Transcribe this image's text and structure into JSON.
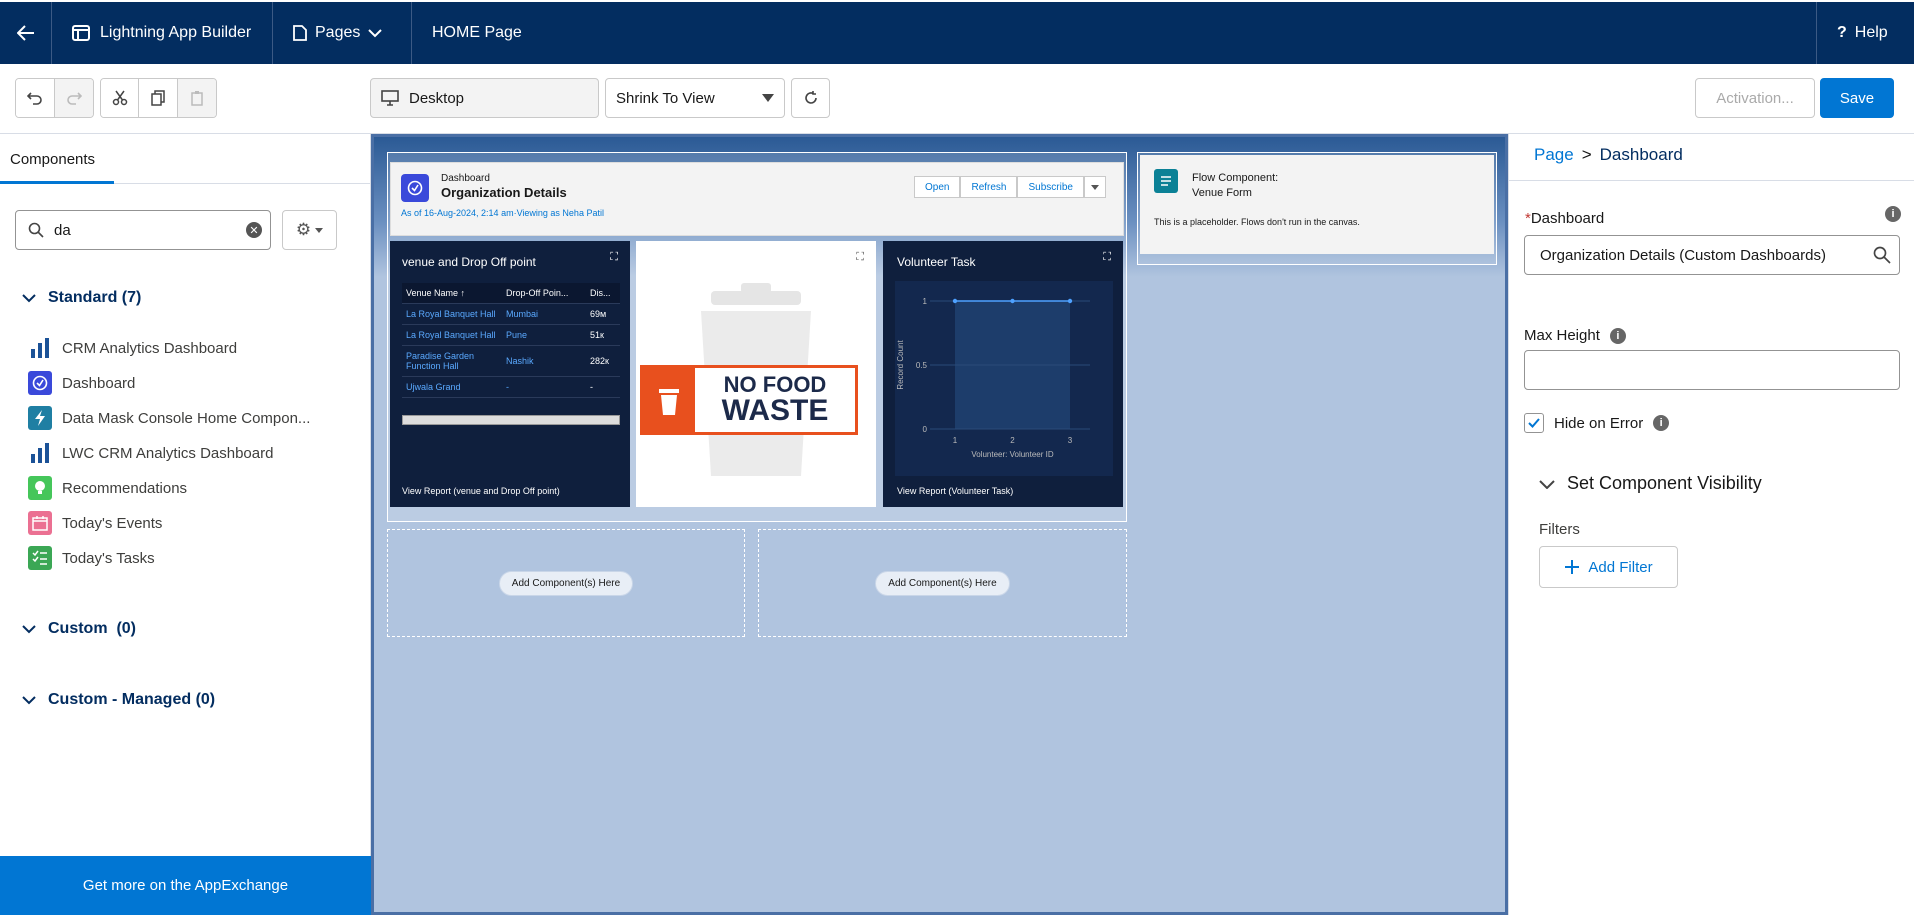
{
  "topbar": {
    "app_builder": "Lightning App Builder",
    "pages": "Pages",
    "page_name": "HOME Page",
    "help": "Help"
  },
  "toolbar": {
    "device": "Desktop",
    "zoom": "Shrink To View",
    "activation": "Activation...",
    "save": "Save"
  },
  "left_panel": {
    "tab": "Components",
    "search_value": "da",
    "groups": {
      "standard": "Standard (7)",
      "custom": "Custom  (0)",
      "custom_managed": "Custom - Managed (0)"
    },
    "components": [
      {
        "label": "CRM Analytics Dashboard",
        "icon": "bar-chart-icon"
      },
      {
        "label": "Dashboard",
        "icon": "dashboard-icon"
      },
      {
        "label": "Data Mask Console Home Compon...",
        "icon": "lightning-icon"
      },
      {
        "label": "LWC CRM Analytics Dashboard",
        "icon": "bar-chart-icon"
      },
      {
        "label": "Recommendations",
        "icon": "lightbulb-icon"
      },
      {
        "label": "Today's Events",
        "icon": "calendar-icon"
      },
      {
        "label": "Today's Tasks",
        "icon": "tasks-icon"
      }
    ],
    "appexchange": "Get more on the AppExchange"
  },
  "canvas": {
    "dashboard": {
      "kicker": "Dashboard",
      "title": "Organization Details",
      "asof": "As of 16-Aug-2024, 2:14 am·Viewing as Neha Patil",
      "open": "Open",
      "refresh": "Refresh",
      "subscribe": "Subscribe"
    },
    "venue_widget": {
      "title": "venue and Drop Off point",
      "columns": [
        "Venue Name ↑",
        "Drop-Off Poin...",
        "Dis..."
      ],
      "rows": [
        [
          "La Royal Banquet Hall",
          "Mumbai",
          "69м"
        ],
        [
          "La Royal Banquet Hall",
          "Pune",
          "51к"
        ],
        [
          "Paradise Garden Function Hall",
          "Nashik",
          "282к"
        ],
        [
          "Ujwala Grand",
          "-",
          "-"
        ]
      ],
      "footer": "View Report (venue and Drop Off point)"
    },
    "image_widget": {
      "line1": "NO FOOD",
      "line2": "WASTE"
    },
    "volunteer_widget": {
      "title": "Volunteer Task",
      "ylabel": "Record Count",
      "xlabel": "Volunteer: Volunteer ID",
      "footer": "View Report (Volunteer Task)"
    },
    "flow": {
      "title": "Flow Component:",
      "name": "Venue Form",
      "note": "This is a placeholder. Flows don't run in the canvas."
    },
    "add_here": "Add Component(s) Here"
  },
  "chart_data": {
    "type": "line",
    "x": [
      1,
      2,
      3
    ],
    "values": [
      1,
      1,
      1
    ],
    "xticks": [
      "1",
      "2",
      "3"
    ],
    "yticks": [
      "0",
      "0.5",
      "1"
    ],
    "ylim": [
      0,
      1
    ],
    "xlabel": "Volunteer: Volunteer ID",
    "ylabel": "Record Count"
  },
  "right_panel": {
    "breadcrumb_page": "Page",
    "breadcrumb_sep": ">",
    "breadcrumb_current": "Dashboard",
    "dashboard_label": "Dashboard",
    "dashboard_value": "Organization Details (Custom Dashboards)",
    "max_height_label": "Max Height",
    "hide_on_error": "Hide on Error",
    "visibility": "Set Component Visibility",
    "filters": "Filters",
    "add_filter": "Add Filter"
  },
  "colors": {
    "nav": "#032d60",
    "brand": "#0176d3",
    "canvas": "#b0c4df"
  }
}
